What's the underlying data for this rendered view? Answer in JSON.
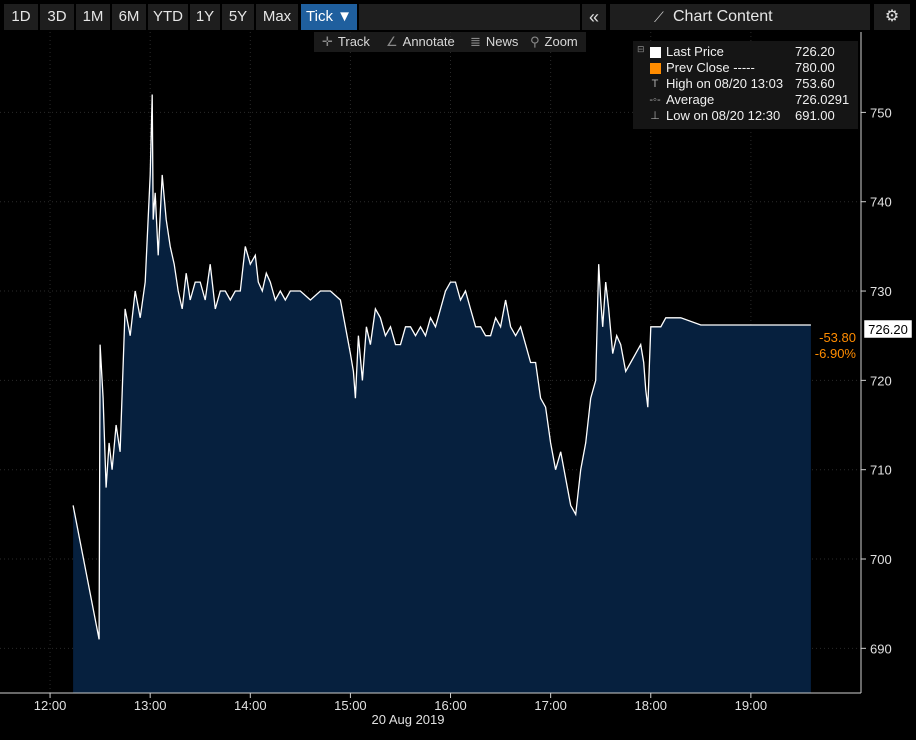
{
  "toolbar": {
    "ranges": [
      "1D",
      "3D",
      "1M",
      "6M",
      "YTD",
      "1Y",
      "5Y",
      "Max",
      "Tick ▼"
    ],
    "active_range": "Tick ▼",
    "collapse_icon": "«",
    "chart_content_label": "Chart Content",
    "chart_content_icon": "line-chart-icon",
    "settings_icon": "gear-icon"
  },
  "subtoolbar": {
    "track": "Track",
    "annotate": "Annotate",
    "news": "News",
    "zoom": "Zoom"
  },
  "legend": {
    "last_price": {
      "label": "Last Price",
      "value": "726.20",
      "color": "#ffffff"
    },
    "prev_close": {
      "label": "Prev Close -----",
      "value": "780.00",
      "color": "#ff8c00"
    },
    "high": {
      "label": "High on 08/20 13:03",
      "value": "753.60"
    },
    "average": {
      "label": "Average",
      "value": "726.0291"
    },
    "low": {
      "label": "Low on 08/20 12:30",
      "value": "691.00"
    }
  },
  "badges": {
    "last": "726.20",
    "change": "-53.80",
    "change_pct": "-6.90%",
    "change_color": "#ff8c00"
  },
  "chart_data": {
    "type": "area",
    "xlabel": "20 Aug 2019",
    "x_ticks": [
      "12:00",
      "13:00",
      "14:00",
      "15:00",
      "16:00",
      "17:00",
      "18:00",
      "19:00"
    ],
    "x_ticks_hours": [
      12,
      13,
      14,
      15,
      16,
      17,
      18,
      19
    ],
    "y_ticks": [
      690,
      700,
      710,
      720,
      730,
      740,
      750
    ],
    "xlim": [
      11.5,
      20.1
    ],
    "ylim": [
      685,
      759
    ],
    "fill_color": "#06203e",
    "line_color": "#ffffff",
    "series": [
      {
        "x": [
          12.23,
          12.49,
          12.5,
          12.53,
          12.56,
          12.59,
          12.62,
          12.66,
          12.7,
          12.75,
          12.8,
          12.85,
          12.9,
          12.95,
          13.0,
          13.02,
          13.03,
          13.05,
          13.08,
          13.12,
          13.16,
          13.2,
          13.24,
          13.28,
          13.32,
          13.36,
          13.4,
          13.45,
          13.5,
          13.55,
          13.6,
          13.65,
          13.7,
          13.75,
          13.8,
          13.85,
          13.9,
          13.95,
          14.0,
          14.05,
          14.08,
          14.12,
          14.16,
          14.2,
          14.25,
          14.3,
          14.35,
          14.4,
          14.5,
          14.6,
          14.7,
          14.8,
          14.9,
          14.95,
          15.0,
          15.03,
          15.05,
          15.08,
          15.12,
          15.16,
          15.2,
          15.25,
          15.3,
          15.35,
          15.4,
          15.45,
          15.5,
          15.55,
          15.6,
          15.65,
          15.7,
          15.75,
          15.8,
          15.85,
          15.9,
          15.95,
          16.0,
          16.05,
          16.1,
          16.15,
          16.2,
          16.25,
          16.3,
          16.35,
          16.4,
          16.45,
          16.5,
          16.55,
          16.6,
          16.65,
          16.7,
          16.75,
          16.8,
          16.85,
          16.9,
          16.95,
          17.0,
          17.05,
          17.1,
          17.15,
          17.2,
          17.25,
          17.3,
          17.35,
          17.4,
          17.45,
          17.48,
          17.5,
          17.52,
          17.55,
          17.58,
          17.62,
          17.66,
          17.7,
          17.75,
          17.8,
          17.85,
          17.9,
          17.93,
          17.95,
          17.97,
          18.0,
          18.05,
          18.1,
          18.15,
          18.2,
          18.3,
          18.5,
          18.8,
          19.2,
          19.6
        ],
        "y": [
          706,
          691,
          724,
          718,
          708,
          713,
          710,
          715,
          712,
          728,
          725,
          730,
          727,
          731,
          743,
          752,
          738,
          741,
          734,
          743,
          738,
          735,
          733,
          730,
          728,
          732,
          729,
          731,
          731,
          729,
          733,
          728,
          730,
          730,
          729,
          730,
          730,
          735,
          733,
          734,
          731,
          730,
          732,
          731,
          729,
          730,
          729,
          730,
          730,
          729,
          730,
          730,
          729,
          726,
          723,
          721,
          718,
          725,
          720,
          726,
          724,
          728,
          727,
          725,
          726,
          724,
          724,
          726,
          726,
          725,
          726,
          725,
          727,
          726,
          728,
          730,
          731,
          731,
          729,
          730,
          728,
          726,
          726,
          725,
          725,
          727,
          726,
          729,
          726,
          725,
          726,
          724,
          722,
          722,
          718,
          717,
          713,
          710,
          712,
          709,
          706,
          705,
          710,
          713,
          718,
          720,
          733,
          729,
          726,
          731,
          728,
          723,
          725,
          724,
          721,
          722,
          723,
          724,
          722,
          719,
          717,
          726,
          726,
          726,
          727,
          727,
          727,
          726.2,
          726.2,
          726.2,
          726.2
        ]
      }
    ]
  }
}
